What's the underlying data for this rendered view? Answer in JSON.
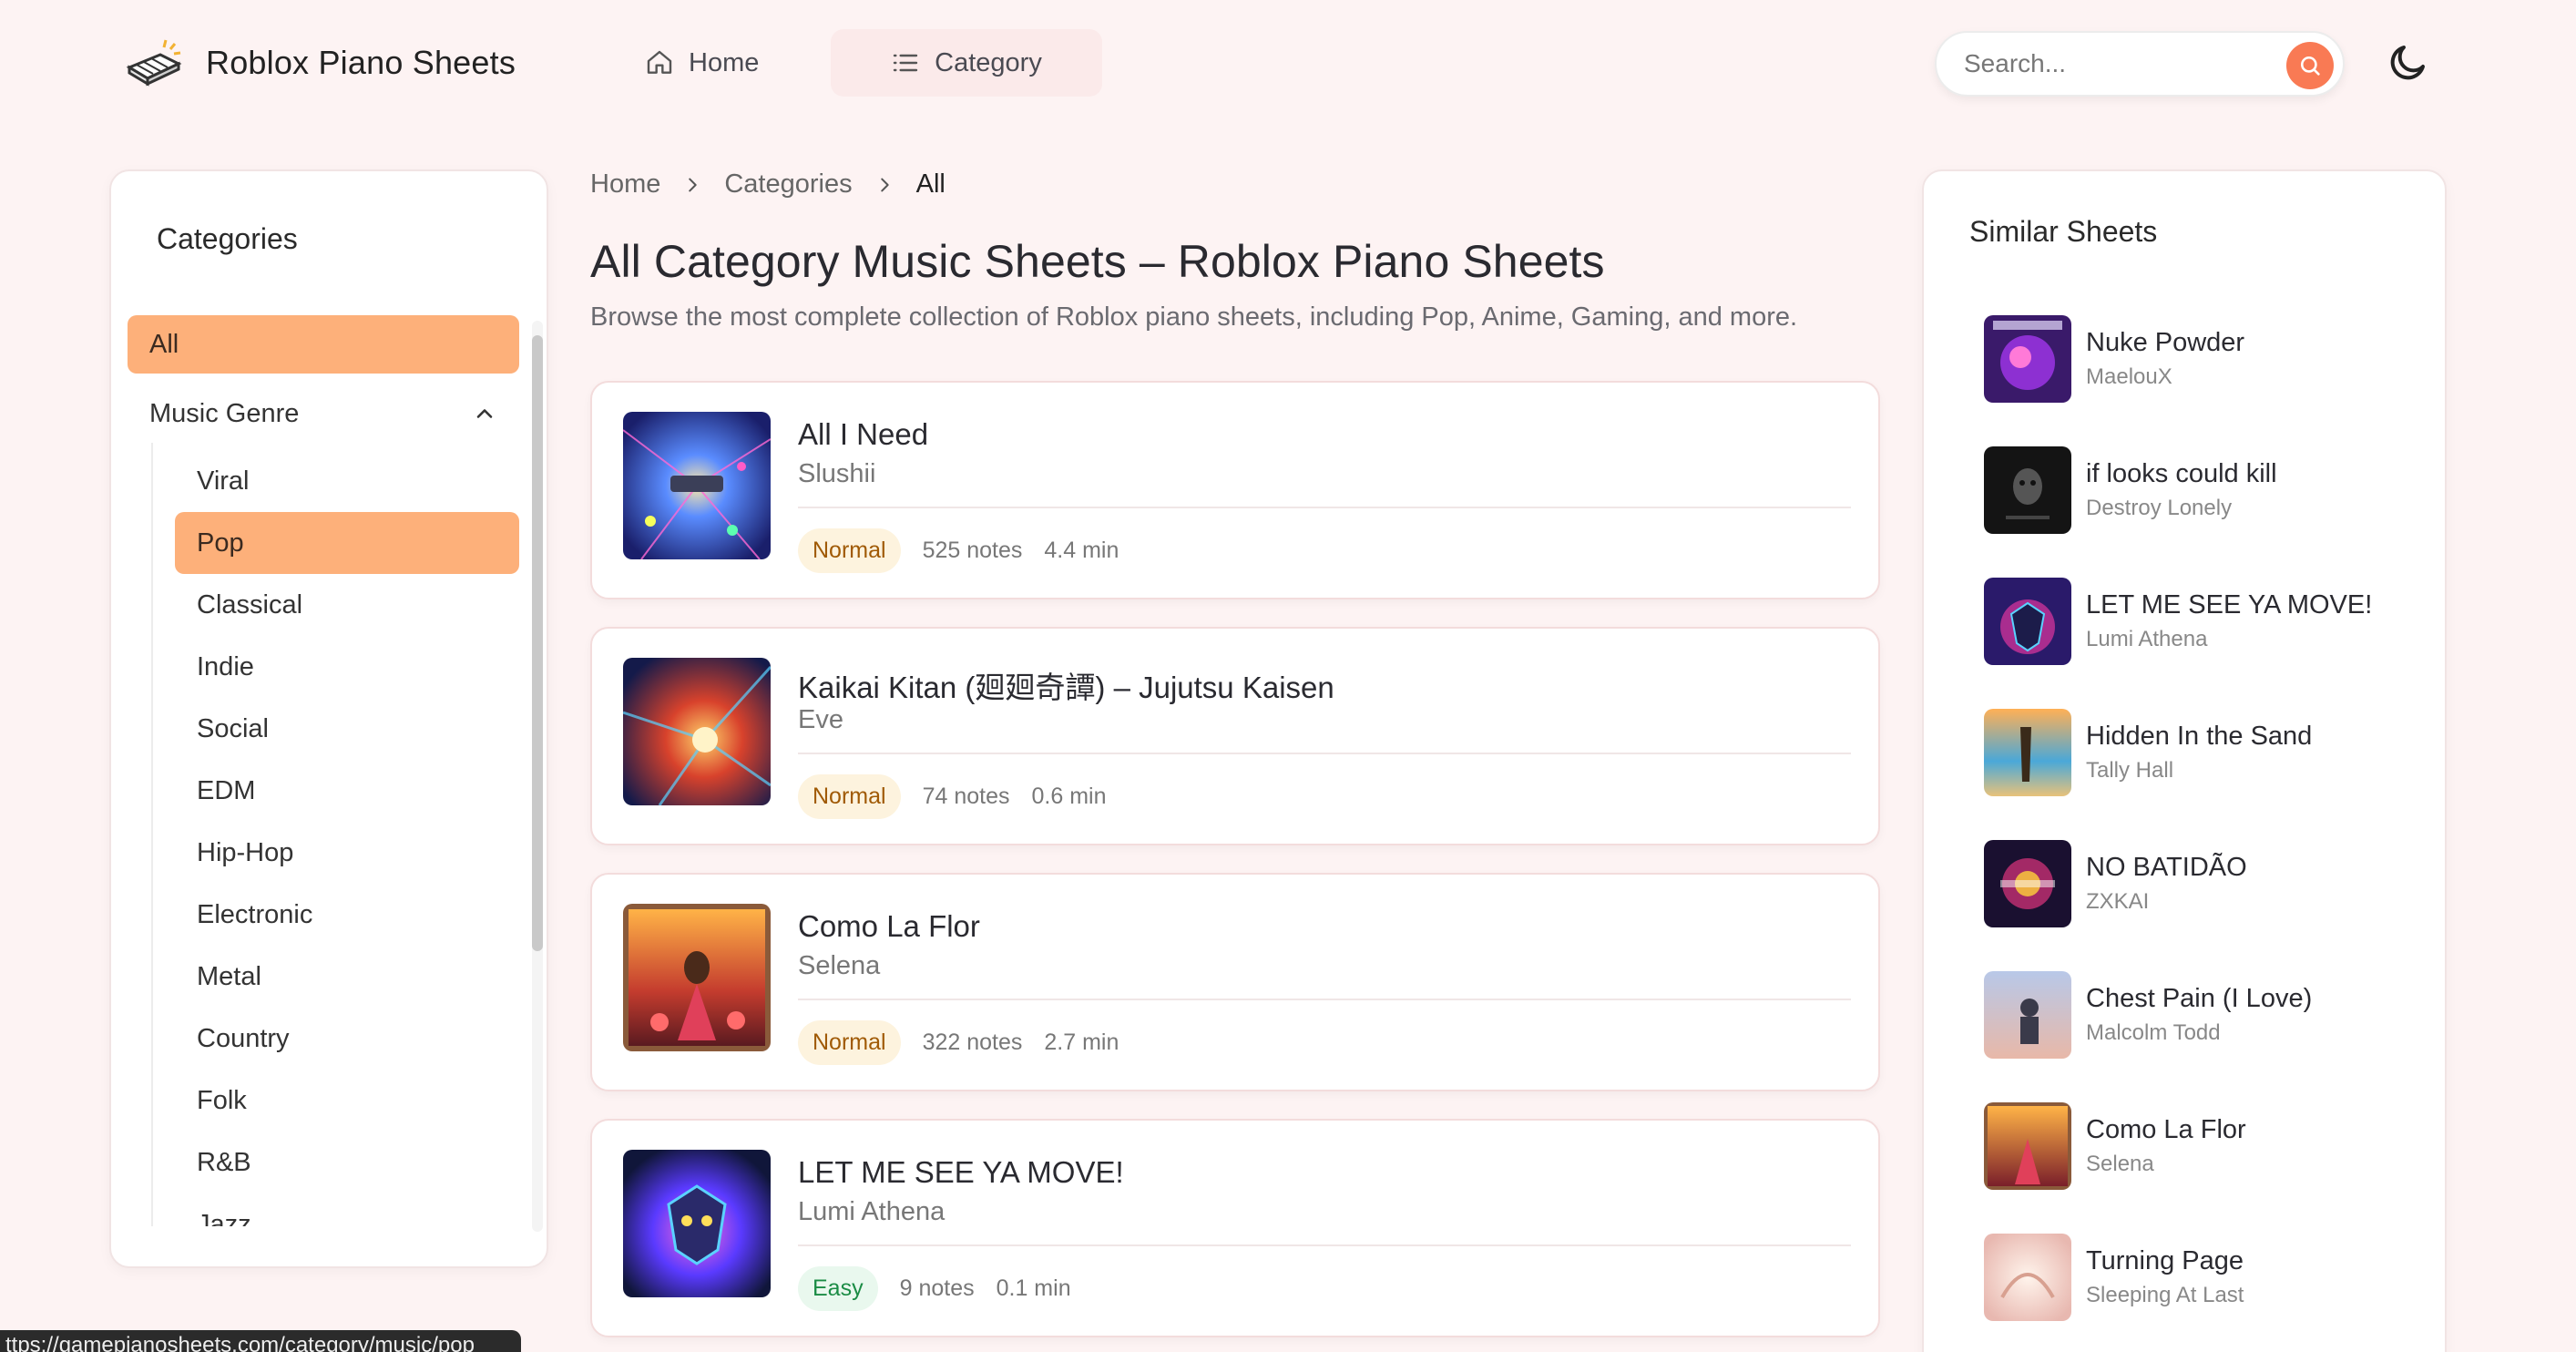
{
  "header": {
    "logo_text": "Roblox Piano Sheets",
    "nav": [
      {
        "label": "Home",
        "icon": "home-icon"
      },
      {
        "label": "Category",
        "icon": "list-icon"
      }
    ],
    "search_placeholder": "Search...",
    "accent": "#f97a54"
  },
  "sidebar": {
    "title": "Categories",
    "all_label": "All",
    "genre_label": "Music Genre",
    "genres": [
      "Viral",
      "Pop",
      "Classical",
      "Indie",
      "Social",
      "EDM",
      "Hip-Hop",
      "Electronic",
      "Metal",
      "Country",
      "Folk",
      "R&B",
      "Jazz"
    ],
    "active_genre": "Pop",
    "active_color": "#fdb07a"
  },
  "breadcrumb": {
    "items": [
      "Home",
      "Categories",
      "All"
    ]
  },
  "main": {
    "title": "All Category Music Sheets – Roblox Piano Sheets",
    "description": "Browse the most complete collection of Roblox piano sheets, including Pop, Anime, Gaming, and more.",
    "cards": [
      {
        "title": "All I Need",
        "artist": "Slushii",
        "difficulty": "Normal",
        "notes": "525 notes",
        "duration": "4.4 min"
      },
      {
        "title": "Kaikai Kitan (廻廻奇譚) – Jujutsu Kaisen",
        "artist": "Eve",
        "difficulty": "Normal",
        "notes": "74 notes",
        "duration": "0.6 min"
      },
      {
        "title": "Como La Flor",
        "artist": "Selena",
        "difficulty": "Normal",
        "notes": "322 notes",
        "duration": "2.7 min"
      },
      {
        "title": "LET ME SEE YA MOVE!",
        "artist": "Lumi Athena",
        "difficulty": "Easy",
        "notes": "9 notes",
        "duration": "0.1 min"
      }
    ]
  },
  "similar": {
    "title": "Similar Sheets",
    "items": [
      {
        "title": "Nuke Powder",
        "artist": "MaelouX"
      },
      {
        "title": "if looks could kill",
        "artist": "Destroy Lonely"
      },
      {
        "title": "LET ME SEE YA MOVE!",
        "artist": "Lumi Athena"
      },
      {
        "title": "Hidden In the Sand",
        "artist": "Tally Hall"
      },
      {
        "title": "NO BATIDÃO",
        "artist": "ZXKAI"
      },
      {
        "title": "Chest Pain (I Love)",
        "artist": "Malcolm Todd"
      },
      {
        "title": "Como La Flor",
        "artist": "Selena"
      },
      {
        "title": "Turning Page",
        "artist": "Sleeping At Last"
      }
    ]
  },
  "status_url": "ttps://gamepianosheets.com/category/music/pop"
}
